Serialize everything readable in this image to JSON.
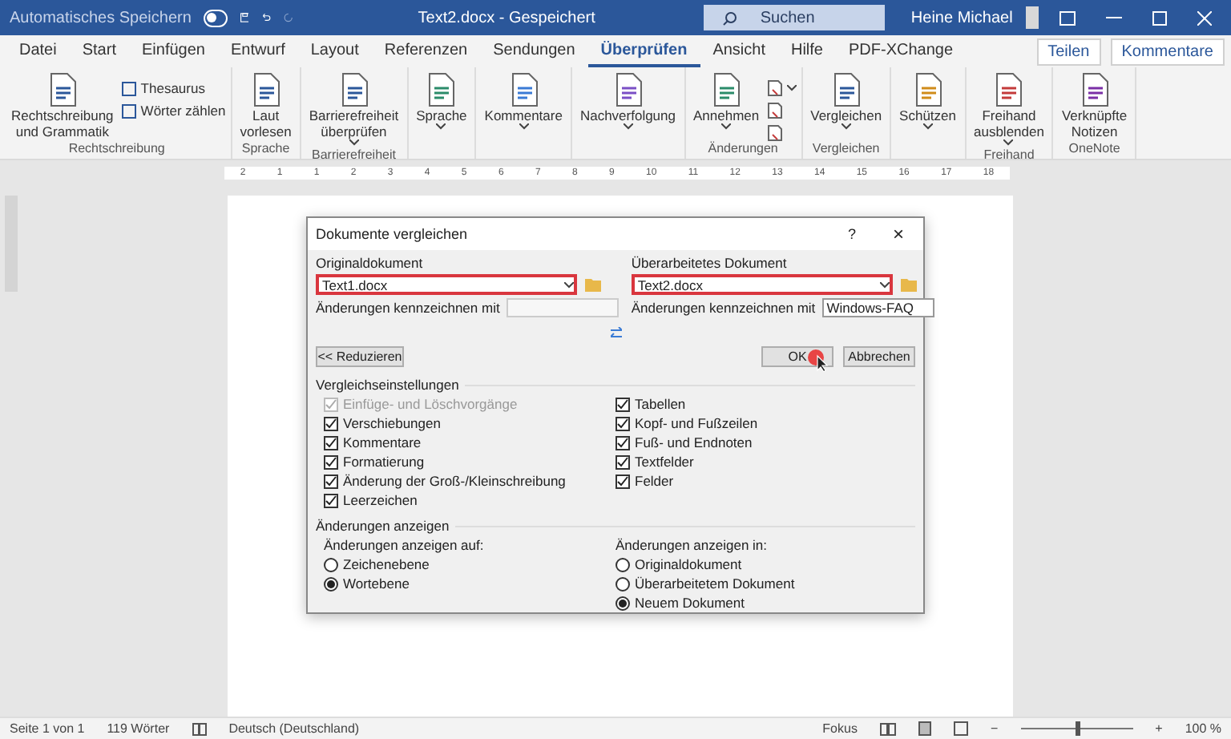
{
  "titlebar": {
    "autosave_label": "Automatisches Speichern",
    "autosave_on": false,
    "document": "Text2.docx - Gespeichert",
    "search_placeholder": "Suchen",
    "user": "Heine Michael"
  },
  "tabs": [
    {
      "label": "Datei",
      "selected": false
    },
    {
      "label": "Start",
      "selected": false
    },
    {
      "label": "Einfügen",
      "selected": false
    },
    {
      "label": "Entwurf",
      "selected": false
    },
    {
      "label": "Layout",
      "selected": false
    },
    {
      "label": "Referenzen",
      "selected": false
    },
    {
      "label": "Sendungen",
      "selected": false
    },
    {
      "label": "Überprüfen",
      "selected": true
    },
    {
      "label": "Ansicht",
      "selected": false
    },
    {
      "label": "Hilfe",
      "selected": false
    },
    {
      "label": "PDF-XChange",
      "selected": false
    }
  ],
  "share_button": "Teilen",
  "comments_button": "Kommentare",
  "ribbon_groups": [
    {
      "label": "Rechtschreibung",
      "buttons": [
        {
          "kind": "large",
          "label": "Rechtschreibung\nund Grammatik",
          "dropdown": false
        },
        {
          "kind": "small",
          "label": "Thesaurus",
          "dropdown": false
        },
        {
          "kind": "small",
          "label": "Wörter zählen",
          "dropdown": false
        }
      ]
    },
    {
      "label": "Sprache",
      "buttons": [
        {
          "kind": "large",
          "label": "Laut\nvorlesen",
          "dropdown": false
        }
      ]
    },
    {
      "label": "Barrierefreiheit",
      "buttons": [
        {
          "kind": "large",
          "label": "Barrierefreiheit\nüberprüfen",
          "dropdown": true
        }
      ]
    },
    {
      "buttons": [
        {
          "kind": "large",
          "label": "Sprache",
          "dropdown": true
        }
      ]
    },
    {
      "buttons": [
        {
          "kind": "large",
          "label": "Kommentare",
          "dropdown": true
        }
      ]
    },
    {
      "buttons": [
        {
          "kind": "large",
          "label": "Nachverfolgung",
          "dropdown": true
        }
      ]
    },
    {
      "label": "Änderungen",
      "buttons": [
        {
          "kind": "large",
          "label": "Annehmen",
          "dropdown": true
        },
        {
          "kind": "icon",
          "dropdown": true
        },
        {
          "kind": "icon",
          "dropdown": false
        },
        {
          "kind": "icon",
          "dropdown": false
        }
      ]
    },
    {
      "label": "Vergleichen",
      "buttons": [
        {
          "kind": "large",
          "label": "Vergleichen",
          "dropdown": true
        }
      ]
    },
    {
      "buttons": [
        {
          "kind": "large",
          "label": "Schützen",
          "dropdown": true
        }
      ]
    },
    {
      "label": "Freihand",
      "buttons": [
        {
          "kind": "large",
          "label": "Freihand\nausblenden",
          "dropdown": true
        }
      ]
    },
    {
      "label": "OneNote",
      "buttons": [
        {
          "kind": "large",
          "label": "Verknüpfte\nNotizen",
          "dropdown": false
        }
      ]
    }
  ],
  "ruler_numbers": [
    "2",
    "1",
    "1",
    "2",
    "3",
    "4",
    "5",
    "6",
    "7",
    "8",
    "9",
    "10",
    "11",
    "12",
    "13",
    "14",
    "15",
    "16",
    "17",
    "18"
  ],
  "dialog": {
    "title": "Dokumente vergleichen",
    "help": "?",
    "close": "×",
    "original": {
      "label": "Originaldokument",
      "value": "Text1.docx",
      "highlighted": true,
      "mark_label": "Änderungen kennzeichnen mit",
      "mark_disabled": true
    },
    "revised": {
      "label": "Überarbeitetes Dokument",
      "value": "Text2.docx",
      "highlighted": true,
      "mark_label": "Änderungen kennzeichnen mit",
      "mark_value": "Windows-FAQ",
      "mark_disabled": false
    },
    "reduce_button": "<< Reduzieren",
    "ok_button": "OK",
    "cancel_button": "Abbrechen",
    "settings_title": "Vergleichseinstellungen",
    "settings_left": [
      {
        "label": "Einfüge- und Löschvorgänge",
        "checked": true,
        "disabled": true
      },
      {
        "label": "Verschiebungen",
        "checked": true,
        "disabled": false
      },
      {
        "label": "Kommentare",
        "checked": true,
        "disabled": false
      },
      {
        "label": "Formatierung",
        "checked": true,
        "disabled": false
      },
      {
        "label": "Änderung der Groß-/Kleinschreibung",
        "checked": true,
        "disabled": false
      },
      {
        "label": "Leerzeichen",
        "checked": true,
        "disabled": false
      }
    ],
    "settings_right": [
      {
        "label": "Tabellen",
        "checked": true,
        "disabled": false
      },
      {
        "label": "Kopf- und Fußzeilen",
        "checked": true,
        "disabled": false
      },
      {
        "label": "Fuß- und Endnoten",
        "checked": true,
        "disabled": false
      },
      {
        "label": "Textfelder",
        "checked": true,
        "disabled": false
      },
      {
        "label": "Felder",
        "checked": true,
        "disabled": false
      }
    ],
    "show_title": "Änderungen anzeigen",
    "show_level": {
      "label": "Änderungen anzeigen auf:",
      "options": [
        {
          "label": "Zeichenebene",
          "selected": false
        },
        {
          "label": "Wortebene",
          "selected": true
        }
      ]
    },
    "show_in": {
      "label": "Änderungen anzeigen in:",
      "options": [
        {
          "label": "Originaldokument",
          "selected": false
        },
        {
          "label": "Überarbeitetem Dokument",
          "selected": false
        },
        {
          "label": "Neuem Dokument",
          "selected": true
        }
      ]
    }
  },
  "status_bar": {
    "page": "Seite 1 von 1",
    "words": "119 Wörter",
    "language": "Deutsch (Deutschland)",
    "focus": "Fokus",
    "zoom": "100 %",
    "zoom_out": "−",
    "zoom_in": "+",
    "zoom_slider": {
      "level": 0.5
    }
  }
}
